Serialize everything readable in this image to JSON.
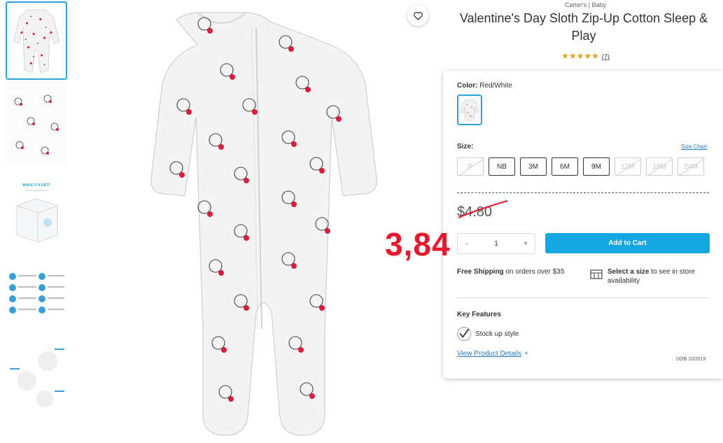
{
  "product": {
    "brand": "Carter's | Baby",
    "title": "Valentine's Day Sloth Zip-Up Cotton Sleep & Play",
    "rating_stars": "★★★★★",
    "review_count": "(7)"
  },
  "thumbnails": [
    {
      "name": "front",
      "selected": true
    },
    {
      "name": "print-detail",
      "selected": false
    },
    {
      "name": "gift-box",
      "selected": false
    },
    {
      "name": "size-chart",
      "selected": false
    },
    {
      "name": "features",
      "selected": false
    }
  ],
  "thumb_texts": {
    "gift_title": "MAKE IT A GIFT!",
    "gift_sub": "with our free bunny box"
  },
  "color": {
    "label": "Color:",
    "value": "Red/White"
  },
  "size": {
    "label": "Size:",
    "chart_link": "Size Chart",
    "options": [
      {
        "label": "P",
        "available": false
      },
      {
        "label": "NB",
        "available": true
      },
      {
        "label": "3M",
        "available": true
      },
      {
        "label": "6M",
        "available": true
      },
      {
        "label": "9M",
        "available": true
      },
      {
        "label": "12M",
        "available": false
      },
      {
        "label": "18M",
        "available": false
      },
      {
        "label": "24M",
        "available": false
      }
    ]
  },
  "price": {
    "original": "$4.80"
  },
  "overlay_price": "3,84",
  "quantity": {
    "minus": "-",
    "value": "1",
    "plus": "+"
  },
  "cart_button": "Add to Cart",
  "shipping": {
    "bold": "Free Shipping",
    "rest": " on orders over $35"
  },
  "store": {
    "bold": "Select a size",
    "rest": " to see in store availability"
  },
  "key_features": {
    "heading": "Key Features",
    "item": "Stock up style",
    "link": "View Product Details",
    "plus": "+"
  },
  "style_code": "DOB 10/2019",
  "colors": {
    "accent": "#13a6e0",
    "star": "#e8a019",
    "heart_print": "#d81e3a",
    "overlay_red": "#e8182c"
  },
  "icons": [
    "heart-icon",
    "check-icon",
    "store-icon"
  ]
}
